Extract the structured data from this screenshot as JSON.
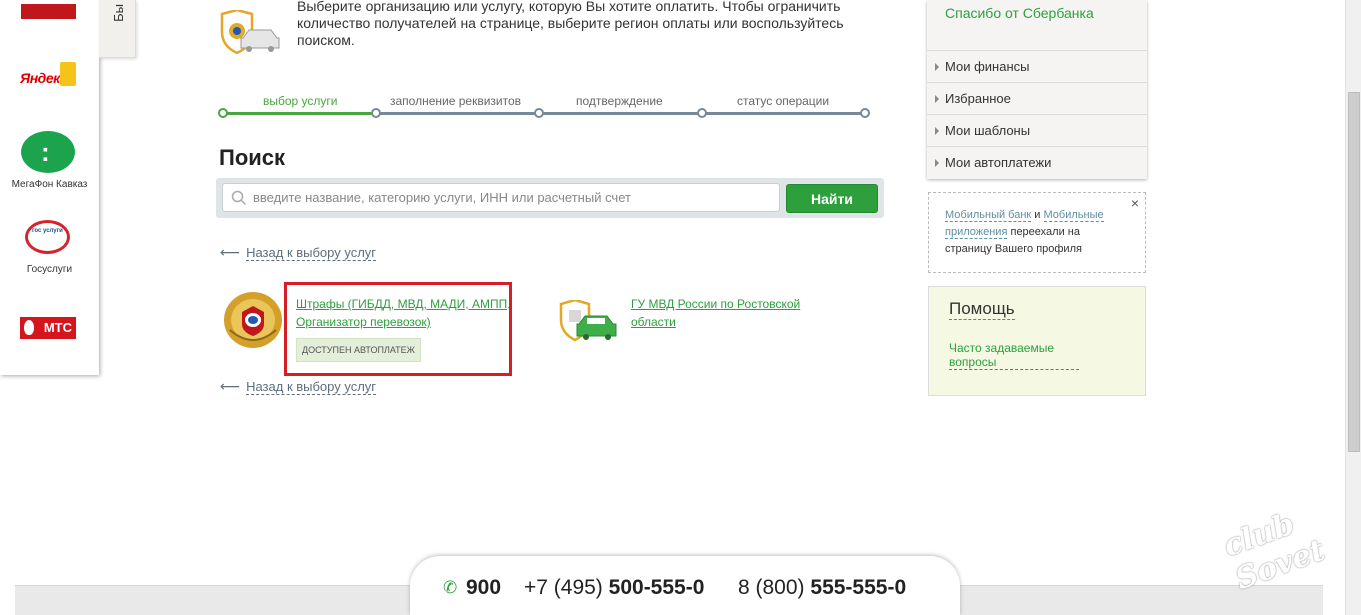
{
  "partners": {
    "items": [
      {
        "label": "",
        "logo": "partner-red-logo"
      },
      {
        "label": "",
        "logo_text": "Яндекс"
      },
      {
        "label": "МегаФон Кавказ"
      },
      {
        "label": "Госуслуги",
        "logo_text": "гос услуги"
      },
      {
        "label": "",
        "logo_text": "МТС"
      }
    ]
  },
  "side_tab": {
    "label": "Бы"
  },
  "intro": {
    "text": "Выберите организацию или услугу, которую Вы хотите оплатить. Чтобы ограничить количество получателей на странице, выберите регион оплаты или воспользуйтесь поиском."
  },
  "progress": {
    "steps": [
      {
        "label": "выбор услуги",
        "active": true
      },
      {
        "label": "заполнение реквизитов",
        "active": false
      },
      {
        "label": "подтверждение",
        "active": false
      },
      {
        "label": "статус операции",
        "active": false
      }
    ]
  },
  "search": {
    "title": "Поиск",
    "placeholder": "введите название, категорию услуги, ИНН или расчетный счет",
    "button_label": "Найти"
  },
  "back_link": {
    "label": "Назад к выбору услуг"
  },
  "results": [
    {
      "title": "Штрафы (ГИБДД, МВД, МАДИ, АМПП, Организатор перевозок)",
      "badge": "ДОСТУПЕН АВТОПЛАТЕЖ",
      "highlighted": true
    },
    {
      "title": "ГУ МВД России по Ростовской области"
    }
  ],
  "right_menu": {
    "thanks_link": "Спасибо от Сбербанка",
    "items": [
      "Мои финансы",
      "Избранное",
      "Мои шаблоны",
      "Мои автоплатежи"
    ]
  },
  "notice": {
    "link1": "Мобильный банк",
    "and": "и",
    "link2": "Мобильные приложения",
    "text": "переехали на страницу Вашего профиля",
    "close": "×"
  },
  "help": {
    "title": "Помощь",
    "link": "Часто задаваемые вопросы"
  },
  "footer": {
    "short_number": "900",
    "phone1_prefix": "+7 (495)",
    "phone1_number": "500-555-0",
    "phone2_prefix": "8 (800)",
    "phone2_number": "555-555-0"
  },
  "watermark": {
    "text": "club Sovet"
  },
  "colors": {
    "accent_green": "#2d9f3c",
    "highlight_red": "#d71d26",
    "help_bg": "#f5f9e3"
  }
}
